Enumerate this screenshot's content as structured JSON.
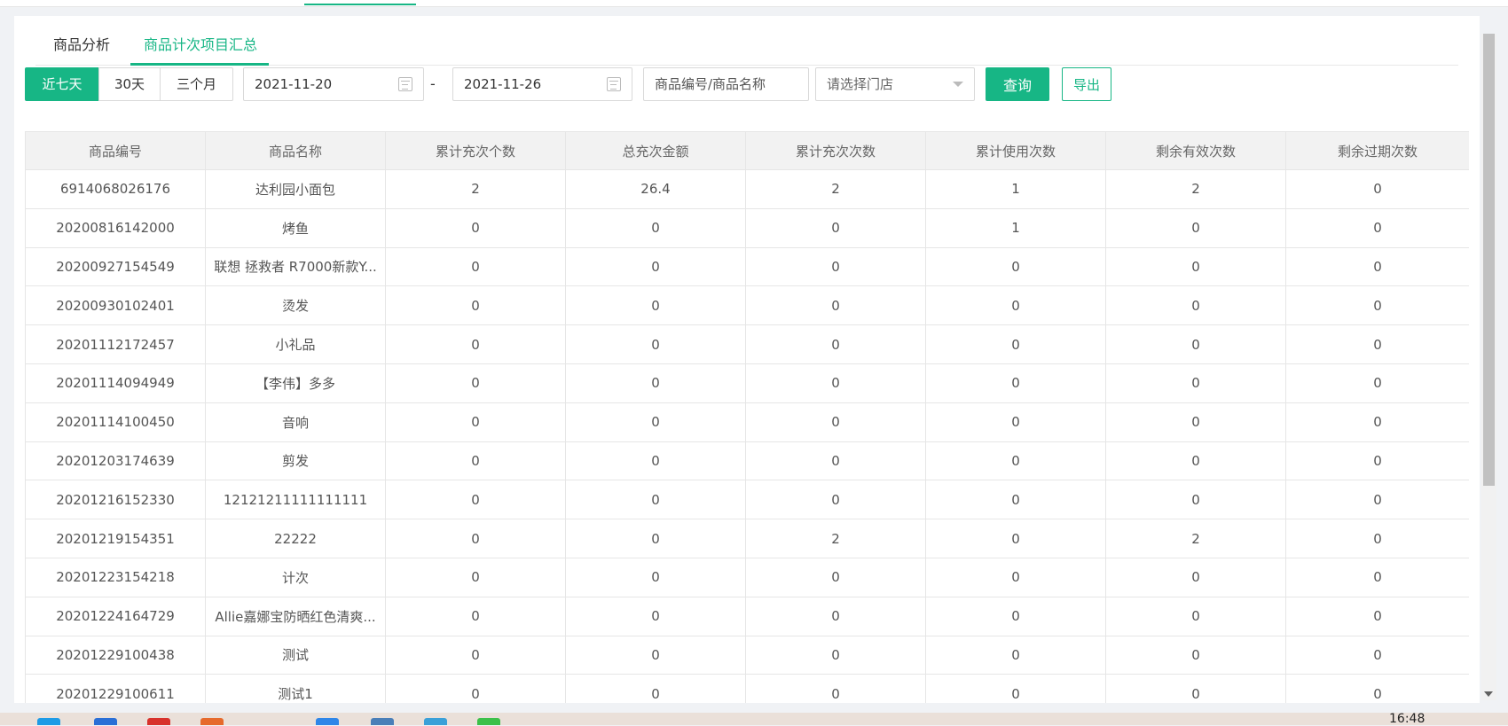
{
  "tabs": [
    {
      "label": "商品分析",
      "active": false
    },
    {
      "label": "商品计次项目汇总",
      "active": true
    }
  ],
  "filters": {
    "ranges": [
      {
        "label": "近七天",
        "active": true
      },
      {
        "label": "30天",
        "active": false
      },
      {
        "label": "三个月",
        "active": false
      }
    ],
    "start_date": "2021-11-20",
    "end_date": "2021-11-26",
    "separator": "-",
    "search_placeholder": "商品编号/商品名称",
    "store_placeholder": "请选择门店",
    "query_label": "查询",
    "export_label": "导出"
  },
  "table": {
    "columns": [
      "商品编号",
      "商品名称",
      "累计充次个数",
      "总充次金额",
      "累计充次次数",
      "累计使用次数",
      "剩余有效次数",
      "剩余过期次数"
    ],
    "rows": [
      [
        "6914068026176",
        "达利园小面包",
        "2",
        "26.4",
        "2",
        "1",
        "2",
        "0"
      ],
      [
        "20200816142000",
        "烤鱼",
        "0",
        "0",
        "0",
        "1",
        "0",
        "0"
      ],
      [
        "20200927154549",
        "联想 拯救者 R7000新款Y...",
        "0",
        "0",
        "0",
        "0",
        "0",
        "0"
      ],
      [
        "20200930102401",
        "烫发",
        "0",
        "0",
        "0",
        "0",
        "0",
        "0"
      ],
      [
        "20201112172457",
        "小礼品",
        "0",
        "0",
        "0",
        "0",
        "0",
        "0"
      ],
      [
        "20201114094949",
        "【李伟】多多",
        "0",
        "0",
        "0",
        "0",
        "0",
        "0"
      ],
      [
        "20201114100450",
        "音响",
        "0",
        "0",
        "0",
        "0",
        "0",
        "0"
      ],
      [
        "20201203174639",
        "剪发",
        "0",
        "0",
        "0",
        "0",
        "0",
        "0"
      ],
      [
        "20201216152330",
        "12121211111111111",
        "0",
        "0",
        "0",
        "0",
        "0",
        "0"
      ],
      [
        "20201219154351",
        "22222",
        "0",
        "0",
        "2",
        "0",
        "2",
        "0"
      ],
      [
        "20201223154218",
        "计次",
        "0",
        "0",
        "0",
        "0",
        "0",
        "0"
      ],
      [
        "20201224164729",
        "Allie嘉娜宝防晒红色清爽...",
        "0",
        "0",
        "0",
        "0",
        "0",
        "0"
      ],
      [
        "20201229100438",
        "测试",
        "0",
        "0",
        "0",
        "0",
        "0",
        "0"
      ],
      [
        "20201229100611",
        "测试1",
        "0",
        "0",
        "0",
        "0",
        "0",
        "0"
      ]
    ]
  },
  "taskbar": {
    "clock": "16:48"
  },
  "colors": {
    "accent": "#17b685",
    "header_bg": "#f2f2f2",
    "border": "#e6e6e6"
  }
}
